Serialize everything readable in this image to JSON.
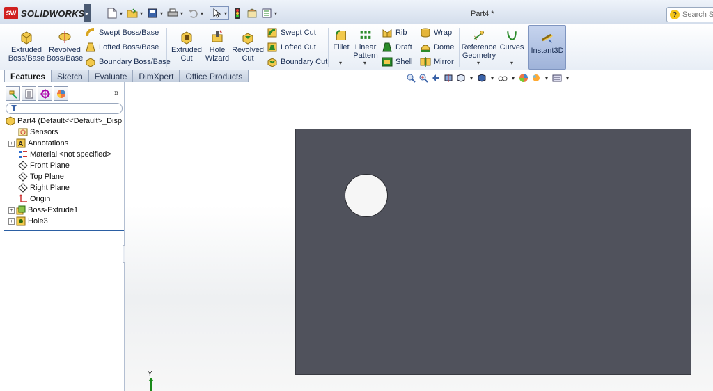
{
  "app": {
    "logo_abbrev": "SW",
    "logo_text": "SOLIDWORKS",
    "document_title": "Part4 *"
  },
  "search": {
    "placeholder": "Search So"
  },
  "ribbon": {
    "extruded_boss": "Extruded\nBoss/Base",
    "revolved_boss": "Revolved\nBoss/Base",
    "swept_boss": "Swept Boss/Base",
    "lofted_boss": "Lofted Boss/Base",
    "boundary_boss": "Boundary Boss/Base",
    "extruded_cut": "Extruded\nCut",
    "hole_wizard": "Hole\nWizard",
    "revolved_cut": "Revolved\nCut",
    "swept_cut": "Swept Cut",
    "lofted_cut": "Lofted Cut",
    "boundary_cut": "Boundary Cut",
    "fillet": "Fillet",
    "linear_pattern": "Linear\nPattern",
    "rib": "Rib",
    "draft": "Draft",
    "shell": "Shell",
    "wrap": "Wrap",
    "dome": "Dome",
    "mirror": "Mirror",
    "reference_geometry": "Reference\nGeometry",
    "curves": "Curves",
    "instant3d": "Instant3D"
  },
  "tabs": [
    "Features",
    "Sketch",
    "Evaluate",
    "DimXpert",
    "Office Products"
  ],
  "tree": {
    "root": "Part4  (Default<<Default>_Disp",
    "items": [
      {
        "label": "Sensors",
        "expandable": false
      },
      {
        "label": "Annotations",
        "expandable": true
      },
      {
        "label": "Material <not specified>",
        "expandable": false
      },
      {
        "label": "Front Plane",
        "expandable": false
      },
      {
        "label": "Top Plane",
        "expandable": false
      },
      {
        "label": "Right Plane",
        "expandable": false
      },
      {
        "label": "Origin",
        "expandable": false
      },
      {
        "label": "Boss-Extrude1",
        "expandable": true
      },
      {
        "label": "Hole3",
        "expandable": true
      }
    ]
  },
  "panel": {
    "more_label": "»"
  },
  "triad": {
    "y_label": "Y"
  },
  "colors": {
    "part_face": "#50525c",
    "accent_blue": "#2b5ea3",
    "logo_red": "#d02020"
  }
}
